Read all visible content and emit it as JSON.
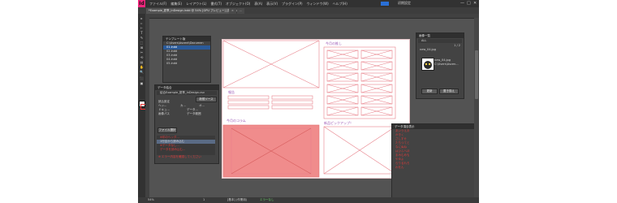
{
  "app": {
    "logo": "Id",
    "menu": [
      "ファイル(F)",
      "編集(E)",
      "レイアウト(L)",
      "書式(T)",
      "オブジェクト(O)",
      "表(A)",
      "表示(V)",
      "プラグイン(P)",
      "ウィンドウ(W)",
      "ヘルプ(H)"
    ],
    "workspace": "初期設定",
    "controls": [
      "—",
      "□",
      "✕"
    ]
  },
  "tabs": [
    "*Example_夏季_InDesign.indd @ 54% [GPU プレビュー] [変換済み]",
    "×",
    "..."
  ],
  "tools": [
    "▸",
    "▹",
    "⊢",
    "T",
    "✎",
    "⬚",
    "⊠",
    "✂",
    "⟲",
    "▤",
    "✋",
    "🔍",
    "⬛",
    "▣"
  ],
  "template_panel": {
    "title": "テンプレート版",
    "path": "C:\\Users\\Ascent\\Documen",
    "files": [
      "01.indd",
      "02.indd",
      "03.indd",
      "04.indd",
      "05.indd"
    ]
  },
  "data_merge_panel": {
    "title": "データ結合",
    "source": "結合Example_夏季_InDesign.csv",
    "label_fields": "新規ソース",
    "subhead": "読込設定",
    "checks": [
      "ヘッ...",
      "カ...",
      "オ...",
      "ドキュ...",
      "データ...",
      "画像パス",
      "データ範囲"
    ],
    "options_btn": "ファイル選択",
    "field_list": [
      "※印のヘッダ...",
      "1行目から読み込む",
      "※データなし...",
      "データを読み込む..."
    ],
    "errors": [
      "※ エラー内容を確認してください",
      "※ エラーがあります"
    ]
  },
  "links_panel": {
    "title": "画像一覧",
    "filter": "ALL",
    "page": "1 / 2",
    "file": "new_04.jpg",
    "thumb_name": "new_04.jpg",
    "thumb_path": "C:\\Users\\Ascen...",
    "buttons": [
      "更新",
      "置き換え"
    ]
  },
  "preview_panel": {
    "title": "データ項目表示",
    "lines": [
      "あいうえお",
      "かきく",
      "さしすせ",
      "たちつてと",
      "なにぬね",
      "はひふへほ",
      "まみむめも",
      "やゆよ",
      "らりるれろ",
      "わをん"
    ]
  },
  "layout_labels": {
    "today_recommend": "今月の推し",
    "report": "報告",
    "column": "今月のコラム",
    "pickup": "新品ピックアップ！"
  },
  "status": {
    "page": "1",
    "style": "[基本] (作業用)",
    "error": "エラーなし",
    "zoom": "54%"
  }
}
